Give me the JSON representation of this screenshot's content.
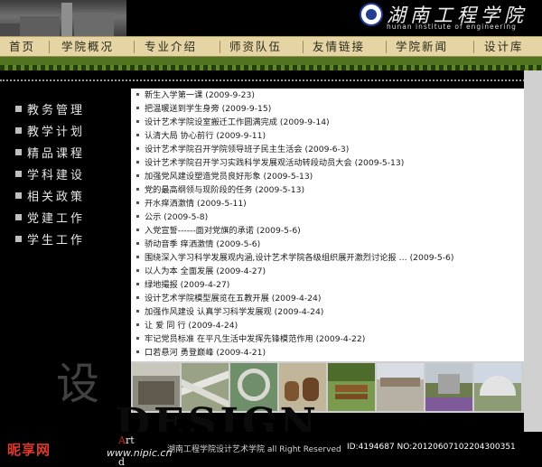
{
  "header": {
    "school_name_cn": "湖南工程学院",
    "school_name_en": "hunan institute of engineering"
  },
  "nav": {
    "items": [
      {
        "label": "首页"
      },
      {
        "label": "学院概况"
      },
      {
        "label": "专业介绍"
      },
      {
        "label": "师资队伍"
      },
      {
        "label": "友情链接"
      },
      {
        "label": "学院新闻"
      },
      {
        "label": "设计库"
      }
    ]
  },
  "sidebar": {
    "items": [
      {
        "label": "教务管理"
      },
      {
        "label": "教学计划"
      },
      {
        "label": "精品课程"
      },
      {
        "label": "学科建设"
      },
      {
        "label": "相关政策"
      },
      {
        "label": "党建工作"
      },
      {
        "label": "学生工作"
      }
    ]
  },
  "news": {
    "items": [
      {
        "text": "新生入学第一课 (2009-9-23)"
      },
      {
        "text": "把温暖送到学生身旁 (2009-9-15)"
      },
      {
        "text": "设计艺术学院设室搬迁工作圆满完成 (2009-9-14)"
      },
      {
        "text": "认清大局 协心前行 (2009-9-11)"
      },
      {
        "text": "设计艺术学院召开学院领导班子民主生活会 (2009-6-3)"
      },
      {
        "text": "设计艺术学院召开学习实践科学发展观活动转段动员大会 (2009-5-13)"
      },
      {
        "text": "加强党风建设塑造党员良好形象 (2009-5-13)"
      },
      {
        "text": "党的最高纲领与现阶段的任务 (2009-5-13)"
      },
      {
        "text": "开水痒洒激情 (2009-5-11)"
      },
      {
        "text": "公示 (2009-5-8)"
      },
      {
        "text": "入党宣誓------面对党旗的承诺 (2009-5-6)"
      },
      {
        "text": "骄动音季 痒洒激情 (2009-5-6)"
      },
      {
        "text": "围绕深入学习科学发展观内涵,设计艺术学院各级组织展开激烈讨论报 … (2009-5-6)"
      },
      {
        "text": "以人为本 全面发展 (2009-4-27)"
      },
      {
        "text": "绿地撮报 (2009-4-27)"
      },
      {
        "text": "设计艺术学院模型展览在五教开展 (2009-4-24)"
      },
      {
        "text": "加强作风建设 认真学习科学发展观 (2009-4-24)"
      },
      {
        "text": "让 爱 同 行 (2009-4-24)"
      },
      {
        "text": "牢记党员标准 在平凡生活中发挥先锋模范作用 (2009-4-22)"
      },
      {
        "text": "口若悬河 勇登巅峰 (2009-4-21)"
      }
    ]
  },
  "photos": {
    "items": [
      {
        "icon": "classroom-photo-icon"
      },
      {
        "icon": "highway-interchange-photo-icon"
      },
      {
        "icon": "road-model-photo-icon"
      },
      {
        "icon": "pottery-jars-photo-icon"
      },
      {
        "icon": "wooden-bench-photo-icon"
      },
      {
        "icon": "campus-square-photo-icon"
      },
      {
        "icon": "campus-building-photo-icon"
      },
      {
        "icon": "circular-building-photo-icon"
      }
    ]
  },
  "footer": {
    "design_word": "DESIGN",
    "art_first_letter": "A",
    "art_rest": "rt",
    "art_line2": "d",
    "copyright": "湖南工程学院设计艺术学院 all Right Reserved"
  },
  "watermark": {
    "sidebar_char": "设",
    "site_name": "昵享网",
    "site_url": "www.nipic.cn",
    "image_id": "ID:4194687 NO:20120607102204300351"
  },
  "colors": {
    "nav_bg": "#e5d4a4",
    "green_band": "#4f731f",
    "panel_bg": "#ffffff",
    "right_bar": "#d0d0d0",
    "accent_red": "#d62222"
  }
}
